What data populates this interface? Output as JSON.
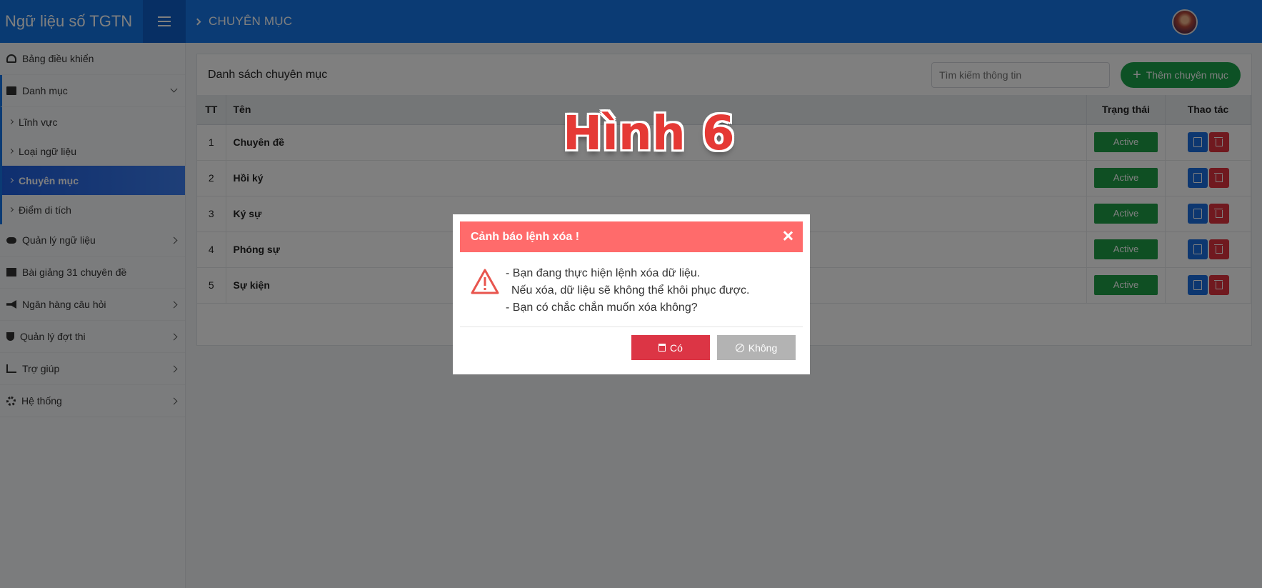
{
  "app": {
    "title": "Ngữ liệu số TGTN"
  },
  "header": {
    "breadcrumb": "CHUYÊN MỤC"
  },
  "sidebar": {
    "items": [
      {
        "label": "Bảng điều khiển",
        "icon": "dashboard-icon"
      },
      {
        "label": "Danh mục",
        "icon": "folder-open-icon"
      },
      {
        "label": "Quản lý ngữ liệu",
        "icon": "cloud-icon"
      },
      {
        "label": "Bài giảng 31 chuyên đề",
        "icon": "archive-icon"
      },
      {
        "label": "Ngân hàng câu hỏi",
        "icon": "megaphone-icon"
      },
      {
        "label": "Quản lý đợt thi",
        "icon": "trophy-icon"
      },
      {
        "label": "Trợ giúp",
        "icon": "chart-line-icon"
      },
      {
        "label": "Hệ thống",
        "icon": "cogs-icon"
      }
    ],
    "subitems": [
      {
        "label": "Lĩnh vực"
      },
      {
        "label": "Loại ngữ liệu"
      },
      {
        "label": "Chuyên mục"
      },
      {
        "label": "Điểm di tích"
      }
    ]
  },
  "main": {
    "title": "Danh sách chuyên mục",
    "search_placeholder": "Tìm kiếm thông tin",
    "add_label": "Thêm chuyên mục",
    "columns": [
      "TT",
      "Tên",
      "Trạng thái",
      "Thao tác"
    ],
    "rows": [
      {
        "tt": "1",
        "name": "Chuyên đề",
        "status": "Active"
      },
      {
        "tt": "2",
        "name": "Hồi ký",
        "status": "Active"
      },
      {
        "tt": "3",
        "name": "Ký sự",
        "status": "Active"
      },
      {
        "tt": "4",
        "name": "Phóng sự",
        "status": "Active"
      },
      {
        "tt": "5",
        "name": "Sự kiện",
        "status": "Active"
      }
    ]
  },
  "overlay_label": "Hình 6",
  "modal": {
    "title": "Cảnh báo lệnh xóa !",
    "line1": "- Bạn đang thực hiện lệnh xóa dữ liệu.",
    "line2": "Nếu xóa, dữ liệu sẽ không thể khôi phục được.",
    "line3": "- Bạn có chắc chắn muốn xóa không?",
    "yes_label": "Có",
    "no_label": "Không"
  },
  "colors": {
    "primary": "#1677e8",
    "success": "#1e9e46",
    "danger": "#dc3545",
    "modal_header": "#ff6b6b"
  }
}
